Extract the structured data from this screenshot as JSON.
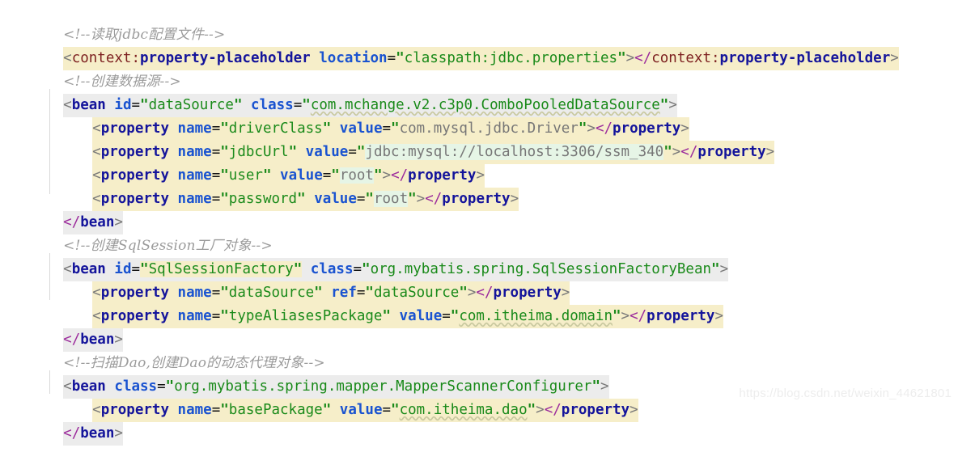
{
  "editor": {
    "language": "xml",
    "background": "#ffffff",
    "colors": {
      "comment": "#9b9b9b",
      "tag": "#14149b",
      "namespace": "#7d2020",
      "attribute": "#1a53d0",
      "value_string": "#1a8a1a",
      "value_plain": "#777777",
      "bracket": "#7a7a7a",
      "closing_slash": "#9c2c9c",
      "highlight_gray": "#ececec",
      "highlight_cream": "#f6eec9",
      "highlight_mint": "#e6f5e6",
      "indent_guide": "#d8d8d8",
      "watermark": "#ededed"
    }
  },
  "lines": {
    "l1": {
      "comment": "<!--读取jdbc配置文件-->"
    },
    "l2": {
      "open_bracket": "<",
      "ns": "context:",
      "tag": "property-placeholder",
      "sp1": " ",
      "attr": "location",
      "eq": "=",
      "q1": "\"",
      "value": "classpath:jdbc.properties",
      "q2": "\"",
      "gt": ">",
      "close_open": "</",
      "close_ns": "context:",
      "close_tag": "property-placeholder",
      "close_gt": ">"
    },
    "l3": {
      "comment": "<!--创建数据源-->"
    },
    "l4": {
      "open_bracket": "<",
      "tag": "bean",
      "attr1": "id",
      "eq1": "=",
      "q1": "\"",
      "val1": "dataSource",
      "q2": "\"",
      "attr2": "class",
      "eq2": "=",
      "q3": "\"",
      "val2": "com.mchange.v2.c3p0.ComboPooledDataSource",
      "q4": "\"",
      "gt": ">"
    },
    "l5": {
      "open_bracket": "<",
      "tag": "property",
      "attr1": "name",
      "eq1": "=",
      "q1": "\"",
      "val1": "driverClass",
      "q2": "\"",
      "attr2": "value",
      "eq2": "=",
      "q3": "\"",
      "val2": "com.mysql.jdbc.Driver",
      "q4": "\"",
      "gt": ">",
      "close_open": "</",
      "close_tag": "property",
      "close_gt": ">"
    },
    "l6": {
      "open_bracket": "<",
      "tag": "property",
      "attr1": "name",
      "eq1": "=",
      "q1": "\"",
      "val1": "jdbcUrl",
      "q2": "\"",
      "attr2": "value",
      "eq2": "=",
      "q3": "\"",
      "val2": "jdbc:mysql://localhost:3306/ssm_340",
      "q4": "\"",
      "gt": ">",
      "close_open": "</",
      "close_tag": "property",
      "close_gt": ">"
    },
    "l7": {
      "open_bracket": "<",
      "tag": "property",
      "attr1": "name",
      "eq1": "=",
      "q1": "\"",
      "val1": "user",
      "q2": "\"",
      "attr2": "value",
      "eq2": "=",
      "q3": "\"",
      "val2": "root",
      "q4": "\"",
      "gt": ">",
      "close_open": "</",
      "close_tag": "property",
      "close_gt": ">"
    },
    "l8": {
      "open_bracket": "<",
      "tag": "property",
      "attr1": "name",
      "eq1": "=",
      "q1": "\"",
      "val1": "password",
      "q2": "\"",
      "attr2": "value",
      "eq2": "=",
      "q3": "\"",
      "val2": "root",
      "q4": "\"",
      "gt": ">",
      "close_open": "</",
      "close_tag": "property",
      "close_gt": ">"
    },
    "l9": {
      "close_open": "</",
      "close_tag": "bean",
      "close_gt": ">"
    },
    "l10": {
      "comment": "<!--创建SqlSession工厂对象-->"
    },
    "l11": {
      "open_bracket": "<",
      "tag": "bean",
      "attr1": "id",
      "eq1": "=",
      "q1": "\"",
      "val1": "SqlSessionFactory",
      "q2": "\"",
      "attr2": "class",
      "eq2": "=",
      "q3": "\"",
      "val2": "org.mybatis.spring.SqlSessionFactoryBean",
      "q4": "\"",
      "gt": ">"
    },
    "l12": {
      "open_bracket": "<",
      "tag": "property",
      "attr1": "name",
      "eq1": "=",
      "q1": "\"",
      "val1": "dataSource",
      "q2": "\"",
      "attr2": "ref",
      "eq2": "=",
      "q3": "\"",
      "val2": "dataSource",
      "q4": "\"",
      "gt": ">",
      "close_open": "</",
      "close_tag": "property",
      "close_gt": ">"
    },
    "l13": {
      "open_bracket": "<",
      "tag": "property",
      "attr1": "name",
      "eq1": "=",
      "q1": "\"",
      "val1": "typeAliasesPackage",
      "q2": "\"",
      "attr2": "value",
      "eq2": "=",
      "q3": "\"",
      "val2": "com.itheima.domain",
      "q4": "\"",
      "gt": ">",
      "close_open": "</",
      "close_tag": "property",
      "close_gt": ">"
    },
    "l14": {
      "close_open": "</",
      "close_tag": "bean",
      "close_gt": ">"
    },
    "l15": {
      "comment": "<!--扫描Dao,创建Dao的动态代理对象-->"
    },
    "l16": {
      "open_bracket": "<",
      "tag": "bean",
      "attr2": "class",
      "eq2": "=",
      "q3": "\"",
      "val2": "org.mybatis.spring.mapper.MapperScannerConfigurer",
      "q4": "\"",
      "gt": ">"
    },
    "l17": {
      "open_bracket": "<",
      "tag": "property",
      "attr1": "name",
      "eq1": "=",
      "q1": "\"",
      "val1": "basePackage",
      "q2": "\"",
      "attr2": "value",
      "eq2": "=",
      "q3": "\"",
      "val2": "com.itheima.dao",
      "q4": "\"",
      "gt": ">",
      "close_open": "</",
      "close_tag": "property",
      "close_gt": ">"
    },
    "l18": {
      "close_open": "</",
      "close_tag": "bean",
      "close_gt": ">"
    }
  },
  "watermark": {
    "text": "https://blog.csdn.net/weixin_44621801"
  }
}
